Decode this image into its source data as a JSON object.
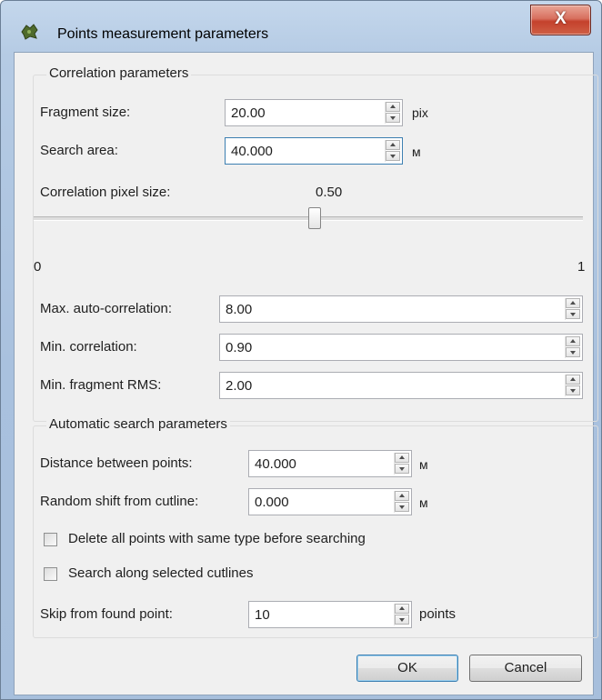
{
  "window": {
    "title": "Points measurement parameters",
    "close_label": "X"
  },
  "correlation": {
    "group_title": "Correlation parameters",
    "fragment_size": {
      "label": "Fragment size:",
      "value": "20.00",
      "unit": "pix"
    },
    "search_area": {
      "label": "Search area:",
      "value": "40.000",
      "unit": "м"
    },
    "pixel_size": {
      "label": "Correlation pixel size:",
      "value_text": "0.50",
      "value": 0.5,
      "min_label": "0",
      "max_label": "1"
    },
    "max_autocorr": {
      "label": "Max. auto-correlation:",
      "value": "8.00"
    },
    "min_corr": {
      "label": "Min. correlation:",
      "value": "0.90"
    },
    "min_rms": {
      "label": "Min. fragment RMS:",
      "value": "2.00"
    }
  },
  "auto": {
    "group_title": "Automatic search parameters",
    "distance": {
      "label": "Distance between points:",
      "value": "40.000",
      "unit": "м"
    },
    "random_shift": {
      "label": "Random shift from cutline:",
      "value": "0.000",
      "unit": "м"
    },
    "delete_all": {
      "label": "Delete all points with same type before searching",
      "checked": false
    },
    "along_cutlines": {
      "label": "Search along selected cutlines",
      "checked": false
    },
    "skip": {
      "label": "Skip from found point:",
      "value": "10",
      "unit": "points"
    }
  },
  "buttons": {
    "ok": "OK",
    "cancel": "Cancel"
  },
  "icons": {
    "app": "app-icon",
    "close": "close-icon"
  }
}
